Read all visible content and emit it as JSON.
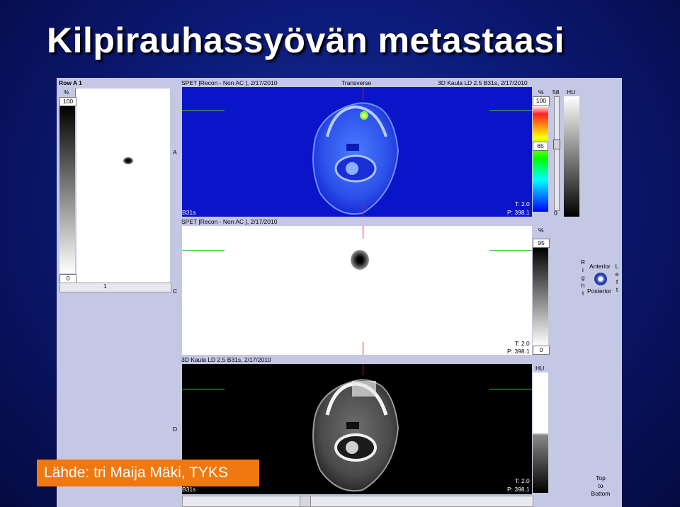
{
  "slide": {
    "title": "Kilpirauhassyövän metastaasi",
    "credit": "Lähde: tri Maija Mäki, TYKS"
  },
  "viewer": {
    "mip_panel": {
      "header": "Row A 1",
      "scale_unit": "%",
      "scale_top": "100",
      "scale_bottom": "0",
      "cursor_box": "8",
      "bottom_tick": "1"
    },
    "labels": {
      "A": "A",
      "C": "C",
      "D": "D"
    },
    "fusion_panel": {
      "left_header": "SPET [Recon - Non AC ], 2/17/2010",
      "center_header": "Transverse",
      "right_header": "3D Kaula LD 2.5 B31s, 2/17/2010",
      "corner_label": "B31s",
      "t_value": "T: 2.0",
      "p_value": "P: 398.1",
      "pct_label": "%",
      "pct_top": "100",
      "pct_mid": "65",
      "ratio_value": "58",
      "hu_label": "HU",
      "hu_bottom": "0"
    },
    "spect_panel": {
      "header": "SPET [Recon - Non AC ], 2/17/2010",
      "t_value": "T: 2.0",
      "p_value": "P: 398.1",
      "pct_label": "%",
      "pct_top": "95",
      "pct_bottom": "0"
    },
    "ct_panel": {
      "header": "3D Kaula LD 2.5 B31s, 2/17/2010",
      "hu_label": "HU",
      "t_value": "T: 2.0",
      "p_value": "P: 398.1",
      "corner_label": "B31s"
    },
    "orientation": {
      "right_letters": [
        "R",
        "i",
        "g",
        "h",
        "t"
      ],
      "anterior": "Anterior",
      "posterior": "Posterior",
      "left_letters": [
        "L",
        "e",
        "f",
        "t"
      ],
      "bottom_lines": [
        "Top",
        "to",
        "Bottom"
      ]
    }
  },
  "colors": {
    "background": "#0c1a78",
    "viewer_frame": "#c4c8e4",
    "fusion_background": "#0a14c8",
    "credit_box": "#f07810"
  }
}
